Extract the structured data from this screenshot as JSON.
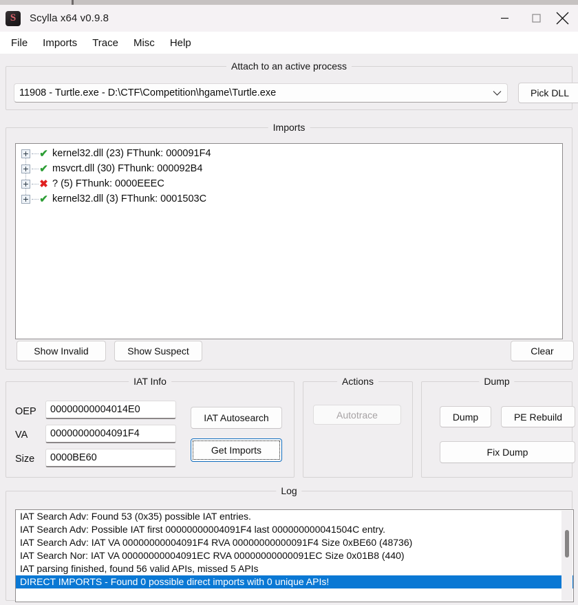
{
  "window": {
    "title": "Scylla x64 v0.9.8",
    "app_icon": "scylla-icon",
    "icon_letter": "S",
    "controls": {
      "minimize": "minimize-icon",
      "maximize": "maximize-icon",
      "close": "close-icon"
    }
  },
  "menubar": {
    "items": [
      {
        "label": "File"
      },
      {
        "label": "Imports"
      },
      {
        "label": "Trace"
      },
      {
        "label": "Misc"
      },
      {
        "label": "Help"
      }
    ]
  },
  "attach": {
    "legend": "Attach to an active process",
    "process_value": "11908 - Turtle.exe - D:\\CTF\\Competition\\hgame\\Turtle.exe",
    "dropdown_icon": "chevron-down-icon",
    "pick_dll_label": "Pick DLL"
  },
  "imports": {
    "legend": "Imports",
    "rows": [
      {
        "status": "valid",
        "status_glyph": "✔",
        "text": "kernel32.dll (23) FThunk: 000091F4"
      },
      {
        "status": "valid",
        "status_glyph": "✔",
        "text": "msvcrt.dll (30) FThunk: 000092B4"
      },
      {
        "status": "invalid",
        "status_glyph": "✖",
        "text": "? (5) FThunk: 0000EEEC"
      },
      {
        "status": "valid",
        "status_glyph": "✔",
        "text": "kernel32.dll (3) FThunk: 0001503C"
      }
    ],
    "show_invalid_label": "Show Invalid",
    "show_suspect_label": "Show Suspect",
    "clear_label": "Clear"
  },
  "iat_info": {
    "legend": "IAT Info",
    "fields": [
      {
        "label": "OEP",
        "value": "00000000004014E0"
      },
      {
        "label": "VA",
        "value": "00000000004091F4"
      },
      {
        "label": "Size",
        "value": "0000BE60"
      }
    ],
    "autosearch_label": "IAT Autosearch",
    "get_imports_label": "Get Imports"
  },
  "actions": {
    "legend": "Actions",
    "autotrace_label": "Autotrace",
    "autotrace_disabled": true
  },
  "dump": {
    "legend": "Dump",
    "dump_label": "Dump",
    "pe_rebuild_label": "PE Rebuild",
    "fix_dump_label": "Fix Dump"
  },
  "log": {
    "legend": "Log",
    "lines": [
      {
        "text": "IAT Search Adv: Found 53 (0x35) possible IAT entries.",
        "selected": false
      },
      {
        "text": "IAT Search Adv: Possible IAT first 00000000004091F4 last 000000000041504C entry.",
        "selected": false
      },
      {
        "text": "IAT Search Adv: IAT VA 00000000004091F4 RVA 00000000000091F4 Size 0xBE60 (48736)",
        "selected": false
      },
      {
        "text": "IAT Search Nor: IAT VA 00000000004091EC RVA 00000000000091EC Size 0x01B8 (440)",
        "selected": false
      },
      {
        "text": "IAT parsing finished, found 56 valid APIs, missed 5 APIs",
        "selected": false
      },
      {
        "text": "DIRECT IMPORTS - Found 0 possible direct imports with 0 unique APIs!",
        "selected": true
      }
    ]
  },
  "colors": {
    "window_bg": "#f0eef0",
    "titlebar_bg": "#f5f2f4",
    "menubar_bg": "#ffffff",
    "selection_blue": "#0a78d4",
    "valid_green": "#2e9e36",
    "invalid_red": "#e02020",
    "focus_blue": "#0f6cbd"
  }
}
